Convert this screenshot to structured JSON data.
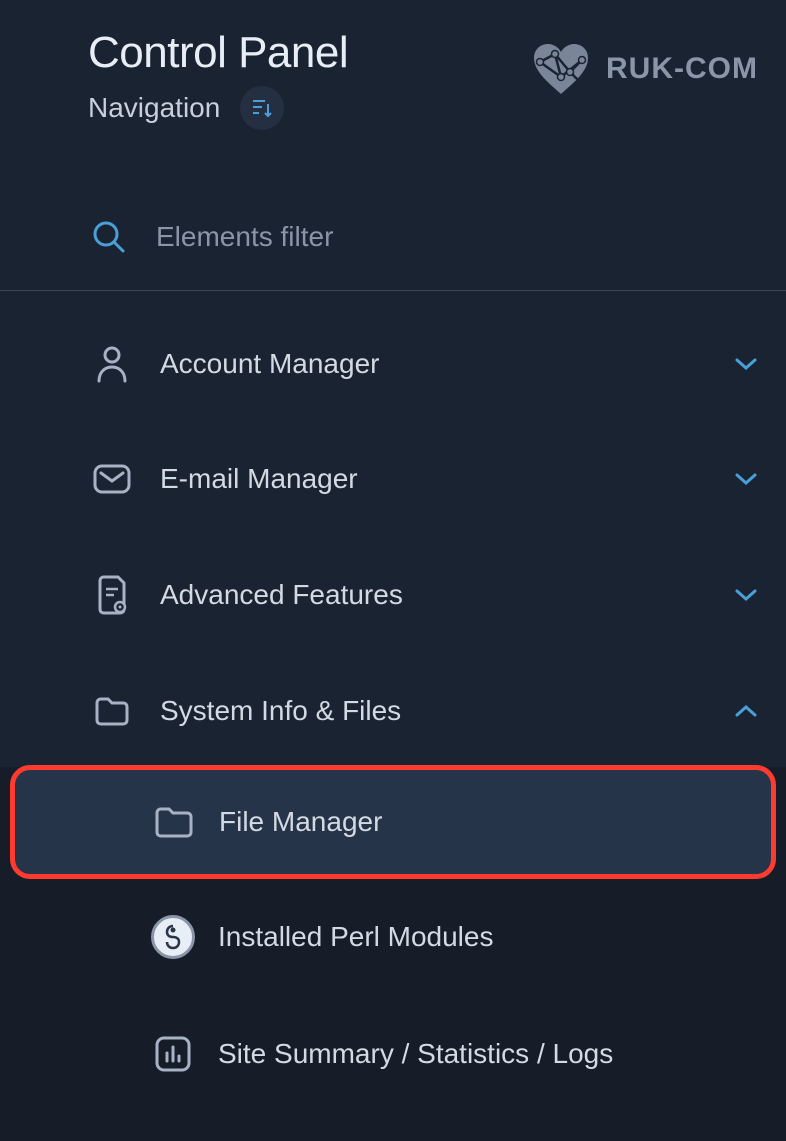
{
  "header": {
    "title": "Control Panel",
    "navigation_label": "Navigation",
    "brand": "RUK-COM"
  },
  "filter": {
    "placeholder": "Elements filter"
  },
  "nav": {
    "items": [
      {
        "label": "Account Manager",
        "icon": "user-icon",
        "expanded": false
      },
      {
        "label": "E-mail Manager",
        "icon": "mail-icon",
        "expanded": false
      },
      {
        "label": "Advanced Features",
        "icon": "document-gear-icon",
        "expanded": false
      },
      {
        "label": "System Info & Files",
        "icon": "folder-icon",
        "expanded": true
      }
    ],
    "system_subitems": [
      {
        "label": "File Manager",
        "icon": "folder-icon",
        "highlighted": true
      },
      {
        "label": "Installed Perl Modules",
        "icon": "perl-icon",
        "highlighted": false
      },
      {
        "label": "Site Summary / Statistics / Logs",
        "icon": "chart-icon",
        "highlighted": false
      }
    ]
  },
  "colors": {
    "accent": "#4a9fd8",
    "highlight_border": "#ff3b30",
    "bg_main": "#1a2332",
    "bg_sub": "#161d29"
  }
}
